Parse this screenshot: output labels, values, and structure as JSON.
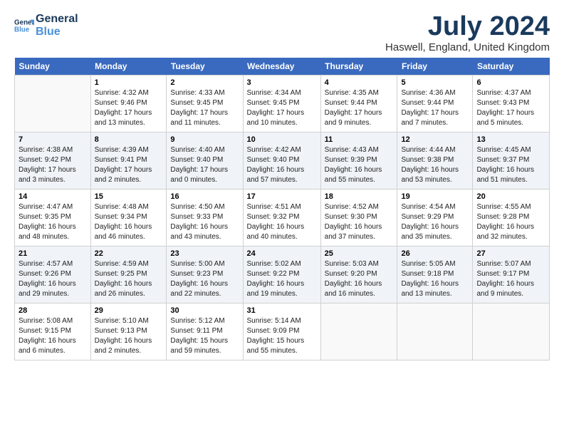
{
  "logo": {
    "line1": "General",
    "line2": "Blue"
  },
  "title": "July 2024",
  "location": "Haswell, England, United Kingdom",
  "days_header": [
    "Sunday",
    "Monday",
    "Tuesday",
    "Wednesday",
    "Thursday",
    "Friday",
    "Saturday"
  ],
  "weeks": [
    [
      {
        "num": "",
        "sunrise": "",
        "sunset": "",
        "daylight": ""
      },
      {
        "num": "1",
        "sunrise": "Sunrise: 4:32 AM",
        "sunset": "Sunset: 9:46 PM",
        "daylight": "Daylight: 17 hours and 13 minutes."
      },
      {
        "num": "2",
        "sunrise": "Sunrise: 4:33 AM",
        "sunset": "Sunset: 9:45 PM",
        "daylight": "Daylight: 17 hours and 11 minutes."
      },
      {
        "num": "3",
        "sunrise": "Sunrise: 4:34 AM",
        "sunset": "Sunset: 9:45 PM",
        "daylight": "Daylight: 17 hours and 10 minutes."
      },
      {
        "num": "4",
        "sunrise": "Sunrise: 4:35 AM",
        "sunset": "Sunset: 9:44 PM",
        "daylight": "Daylight: 17 hours and 9 minutes."
      },
      {
        "num": "5",
        "sunrise": "Sunrise: 4:36 AM",
        "sunset": "Sunset: 9:44 PM",
        "daylight": "Daylight: 17 hours and 7 minutes."
      },
      {
        "num": "6",
        "sunrise": "Sunrise: 4:37 AM",
        "sunset": "Sunset: 9:43 PM",
        "daylight": "Daylight: 17 hours and 5 minutes."
      }
    ],
    [
      {
        "num": "7",
        "sunrise": "Sunrise: 4:38 AM",
        "sunset": "Sunset: 9:42 PM",
        "daylight": "Daylight: 17 hours and 3 minutes."
      },
      {
        "num": "8",
        "sunrise": "Sunrise: 4:39 AM",
        "sunset": "Sunset: 9:41 PM",
        "daylight": "Daylight: 17 hours and 2 minutes."
      },
      {
        "num": "9",
        "sunrise": "Sunrise: 4:40 AM",
        "sunset": "Sunset: 9:40 PM",
        "daylight": "Daylight: 17 hours and 0 minutes."
      },
      {
        "num": "10",
        "sunrise": "Sunrise: 4:42 AM",
        "sunset": "Sunset: 9:40 PM",
        "daylight": "Daylight: 16 hours and 57 minutes."
      },
      {
        "num": "11",
        "sunrise": "Sunrise: 4:43 AM",
        "sunset": "Sunset: 9:39 PM",
        "daylight": "Daylight: 16 hours and 55 minutes."
      },
      {
        "num": "12",
        "sunrise": "Sunrise: 4:44 AM",
        "sunset": "Sunset: 9:38 PM",
        "daylight": "Daylight: 16 hours and 53 minutes."
      },
      {
        "num": "13",
        "sunrise": "Sunrise: 4:45 AM",
        "sunset": "Sunset: 9:37 PM",
        "daylight": "Daylight: 16 hours and 51 minutes."
      }
    ],
    [
      {
        "num": "14",
        "sunrise": "Sunrise: 4:47 AM",
        "sunset": "Sunset: 9:35 PM",
        "daylight": "Daylight: 16 hours and 48 minutes."
      },
      {
        "num": "15",
        "sunrise": "Sunrise: 4:48 AM",
        "sunset": "Sunset: 9:34 PM",
        "daylight": "Daylight: 16 hours and 46 minutes."
      },
      {
        "num": "16",
        "sunrise": "Sunrise: 4:50 AM",
        "sunset": "Sunset: 9:33 PM",
        "daylight": "Daylight: 16 hours and 43 minutes."
      },
      {
        "num": "17",
        "sunrise": "Sunrise: 4:51 AM",
        "sunset": "Sunset: 9:32 PM",
        "daylight": "Daylight: 16 hours and 40 minutes."
      },
      {
        "num": "18",
        "sunrise": "Sunrise: 4:52 AM",
        "sunset": "Sunset: 9:30 PM",
        "daylight": "Daylight: 16 hours and 37 minutes."
      },
      {
        "num": "19",
        "sunrise": "Sunrise: 4:54 AM",
        "sunset": "Sunset: 9:29 PM",
        "daylight": "Daylight: 16 hours and 35 minutes."
      },
      {
        "num": "20",
        "sunrise": "Sunrise: 4:55 AM",
        "sunset": "Sunset: 9:28 PM",
        "daylight": "Daylight: 16 hours and 32 minutes."
      }
    ],
    [
      {
        "num": "21",
        "sunrise": "Sunrise: 4:57 AM",
        "sunset": "Sunset: 9:26 PM",
        "daylight": "Daylight: 16 hours and 29 minutes."
      },
      {
        "num": "22",
        "sunrise": "Sunrise: 4:59 AM",
        "sunset": "Sunset: 9:25 PM",
        "daylight": "Daylight: 16 hours and 26 minutes."
      },
      {
        "num": "23",
        "sunrise": "Sunrise: 5:00 AM",
        "sunset": "Sunset: 9:23 PM",
        "daylight": "Daylight: 16 hours and 22 minutes."
      },
      {
        "num": "24",
        "sunrise": "Sunrise: 5:02 AM",
        "sunset": "Sunset: 9:22 PM",
        "daylight": "Daylight: 16 hours and 19 minutes."
      },
      {
        "num": "25",
        "sunrise": "Sunrise: 5:03 AM",
        "sunset": "Sunset: 9:20 PM",
        "daylight": "Daylight: 16 hours and 16 minutes."
      },
      {
        "num": "26",
        "sunrise": "Sunrise: 5:05 AM",
        "sunset": "Sunset: 9:18 PM",
        "daylight": "Daylight: 16 hours and 13 minutes."
      },
      {
        "num": "27",
        "sunrise": "Sunrise: 5:07 AM",
        "sunset": "Sunset: 9:17 PM",
        "daylight": "Daylight: 16 hours and 9 minutes."
      }
    ],
    [
      {
        "num": "28",
        "sunrise": "Sunrise: 5:08 AM",
        "sunset": "Sunset: 9:15 PM",
        "daylight": "Daylight: 16 hours and 6 minutes."
      },
      {
        "num": "29",
        "sunrise": "Sunrise: 5:10 AM",
        "sunset": "Sunset: 9:13 PM",
        "daylight": "Daylight: 16 hours and 2 minutes."
      },
      {
        "num": "30",
        "sunrise": "Sunrise: 5:12 AM",
        "sunset": "Sunset: 9:11 PM",
        "daylight": "Daylight: 15 hours and 59 minutes."
      },
      {
        "num": "31",
        "sunrise": "Sunrise: 5:14 AM",
        "sunset": "Sunset: 9:09 PM",
        "daylight": "Daylight: 15 hours and 55 minutes."
      },
      {
        "num": "",
        "sunrise": "",
        "sunset": "",
        "daylight": ""
      },
      {
        "num": "",
        "sunrise": "",
        "sunset": "",
        "daylight": ""
      },
      {
        "num": "",
        "sunrise": "",
        "sunset": "",
        "daylight": ""
      }
    ]
  ]
}
